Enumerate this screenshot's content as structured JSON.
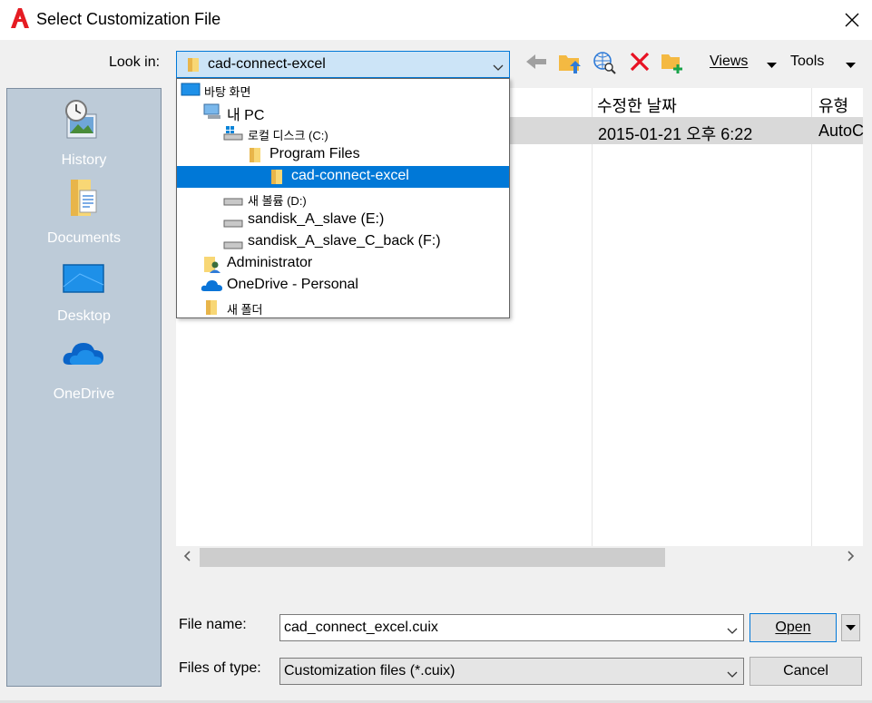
{
  "window": {
    "title": "Select Customization File"
  },
  "lookin": {
    "label": "Look in:",
    "value": "cad-connect-excel"
  },
  "toolbar": {
    "views_label": "Views",
    "tools_label": "Tools"
  },
  "places": [
    {
      "label": "History"
    },
    {
      "label": "Documents"
    },
    {
      "label": "Desktop"
    },
    {
      "label": "OneDrive"
    }
  ],
  "filelist": {
    "columns": [
      "수정한 날짜",
      "유형"
    ],
    "rows": [
      {
        "modified": "2015-01-21 오후 6:22",
        "type": "AutoC"
      }
    ]
  },
  "dropdown": {
    "items": [
      {
        "label": "바탕 화면",
        "icon": "desktop-icon"
      },
      {
        "label": "내 PC",
        "icon": "pc-icon"
      },
      {
        "label": "로컬 디스크 (C:)",
        "icon": "drive-icon"
      },
      {
        "label": "Program Files",
        "icon": "folder-icon"
      },
      {
        "label": "cad-connect-excel",
        "icon": "folder-icon",
        "selected": true
      },
      {
        "label": "새 볼륨 (D:)",
        "icon": "drive-icon"
      },
      {
        "label": "sandisk_A_slave (E:)",
        "icon": "drive-icon"
      },
      {
        "label": "sandisk_A_slave_C_back (F:)",
        "icon": "drive-icon"
      },
      {
        "label": "Administrator",
        "icon": "user-folder-icon"
      },
      {
        "label": "OneDrive - Personal",
        "icon": "cloud-icon"
      },
      {
        "label": "새 폴더",
        "icon": "folder-icon"
      }
    ]
  },
  "form": {
    "filename_label": "File name:",
    "filename_value": "cad_connect_excel.cuix",
    "filetype_label": "Files of type:",
    "filetype_value": "Customization files (*.cuix)",
    "open_label": "Open",
    "cancel_label": "Cancel"
  },
  "colors": {
    "accent": "#0078d7",
    "selection": "#0078d7",
    "places_bg": "#bdcbd8"
  }
}
